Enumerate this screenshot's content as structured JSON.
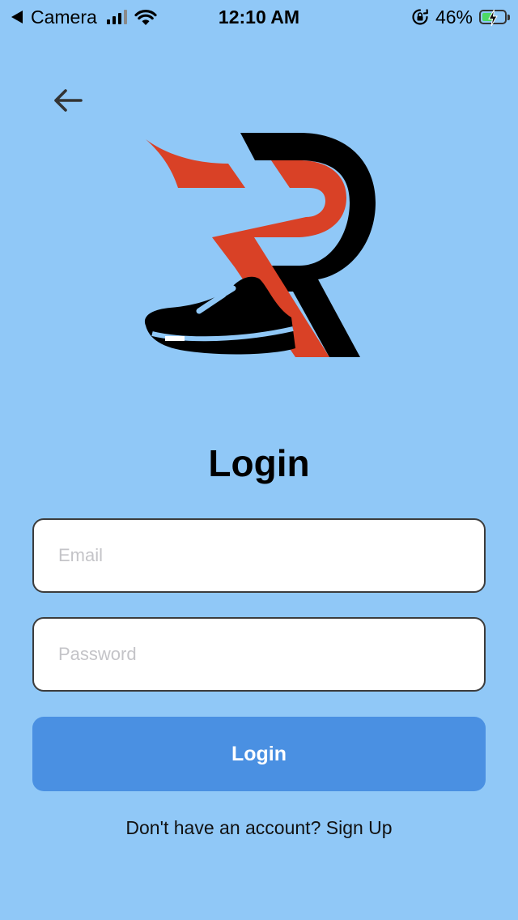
{
  "status_bar": {
    "back_app": "Camera",
    "time": "12:10 AM",
    "battery_percent": "46%",
    "battery_level": 0.46,
    "battery_charging": true,
    "icons": [
      "back-triangle-icon",
      "cellular-signal-icon",
      "wifi-icon",
      "orientation-lock-icon",
      "battery-icon"
    ]
  },
  "nav": {
    "back_icon": "arrow-left-icon"
  },
  "logo": {
    "name": "r-sneaker-logo",
    "colors": {
      "red": "#d94126",
      "black": "#000000"
    }
  },
  "form": {
    "title": "Login",
    "email_placeholder": "Email",
    "email_value": "",
    "password_placeholder": "Password",
    "password_value": "",
    "submit_label": "Login"
  },
  "footer": {
    "prompt": "Don't have an account? ",
    "signup_label": "Sign Up"
  },
  "colors": {
    "background": "#90c8f7",
    "button": "#4a90e2",
    "button_text": "#ffffff",
    "field_border": "#3c3c3c",
    "placeholder": "#c4c4c8"
  }
}
